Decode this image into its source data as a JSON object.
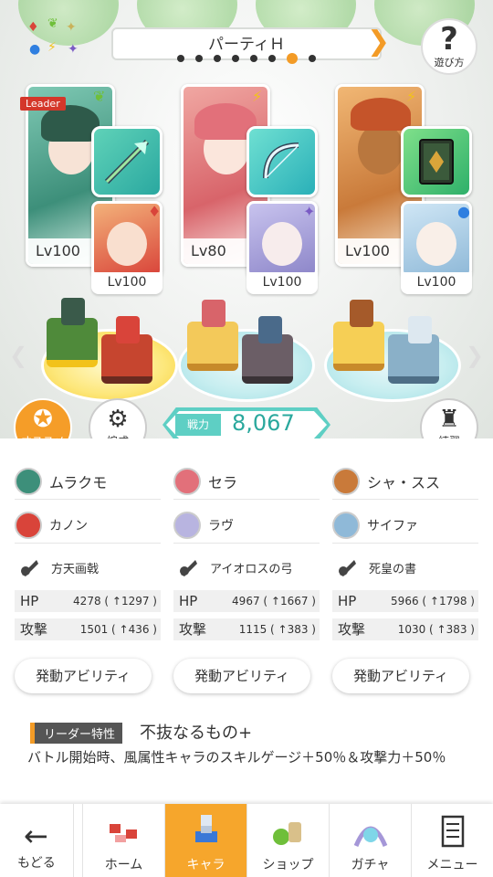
{
  "header": {
    "party_title": "パーティＨ",
    "help_label": "遊び方",
    "page_count": 8,
    "active_page": 7
  },
  "units": [
    {
      "leader_badge": "Leader",
      "main_level": "Lv100",
      "sub_level": "Lv100",
      "main_element": "wind",
      "sub_element": "fire",
      "weapon_icon": "halberd-icon",
      "main_name": "ムラクモ",
      "sub_name": "カノン",
      "weapon_name": "方天画戟",
      "hp_label": "HP",
      "hp_value": "4278 ( ↑1297 )",
      "atk_label": "攻撃",
      "atk_value": "1501 ( ↑436 )",
      "ability_label": "発動アビリティ"
    },
    {
      "leader_badge": "",
      "main_level": "Lv80",
      "sub_level": "Lv100",
      "main_element": "thunder",
      "sub_element": "dark",
      "weapon_icon": "bow-icon",
      "main_name": "セラ",
      "sub_name": "ラヴ",
      "weapon_name": "アイオロスの弓",
      "hp_label": "HP",
      "hp_value": "4967 ( ↑1667 )",
      "atk_label": "攻撃",
      "atk_value": "1115 ( ↑383 )",
      "ability_label": "発動アビリティ"
    },
    {
      "leader_badge": "",
      "main_level": "Lv100",
      "sub_level": "Lv100",
      "main_element": "thunder",
      "sub_element": "water",
      "weapon_icon": "book-icon",
      "main_name": "シャ・スス",
      "sub_name": "サイファ",
      "weapon_name": "死皇の書",
      "hp_label": "HP",
      "hp_value": "5966 ( ↑1798 )",
      "atk_label": "攻撃",
      "atk_value": "1030 ( ↑383 )",
      "ability_label": "発動アビリティ"
    }
  ],
  "controls": {
    "recommend_label": "オススメ",
    "formation_label": "編成",
    "power_label": "戦力",
    "power_value": "8,067",
    "practice_label": "練習"
  },
  "leader_skill": {
    "tag": "リーダー特性",
    "name": "不抜なるもの+",
    "description": "バトル開始時、風属性キャラのスキルゲージ＋50％＆攻撃力＋50％"
  },
  "nav": {
    "back": "もどる",
    "home": "ホーム",
    "chara": "キャラ",
    "shop": "ショップ",
    "gacha": "ガチャ",
    "menu": "メニュー",
    "active": "chara"
  },
  "colors": {
    "accent": "#f39b26",
    "teal": "#5ecfc4",
    "wind": "#6fbf3a",
    "thunder": "#f2c21b",
    "fire": "#d9443a",
    "water": "#2f7fe0",
    "dark": "#7a5bc4"
  }
}
